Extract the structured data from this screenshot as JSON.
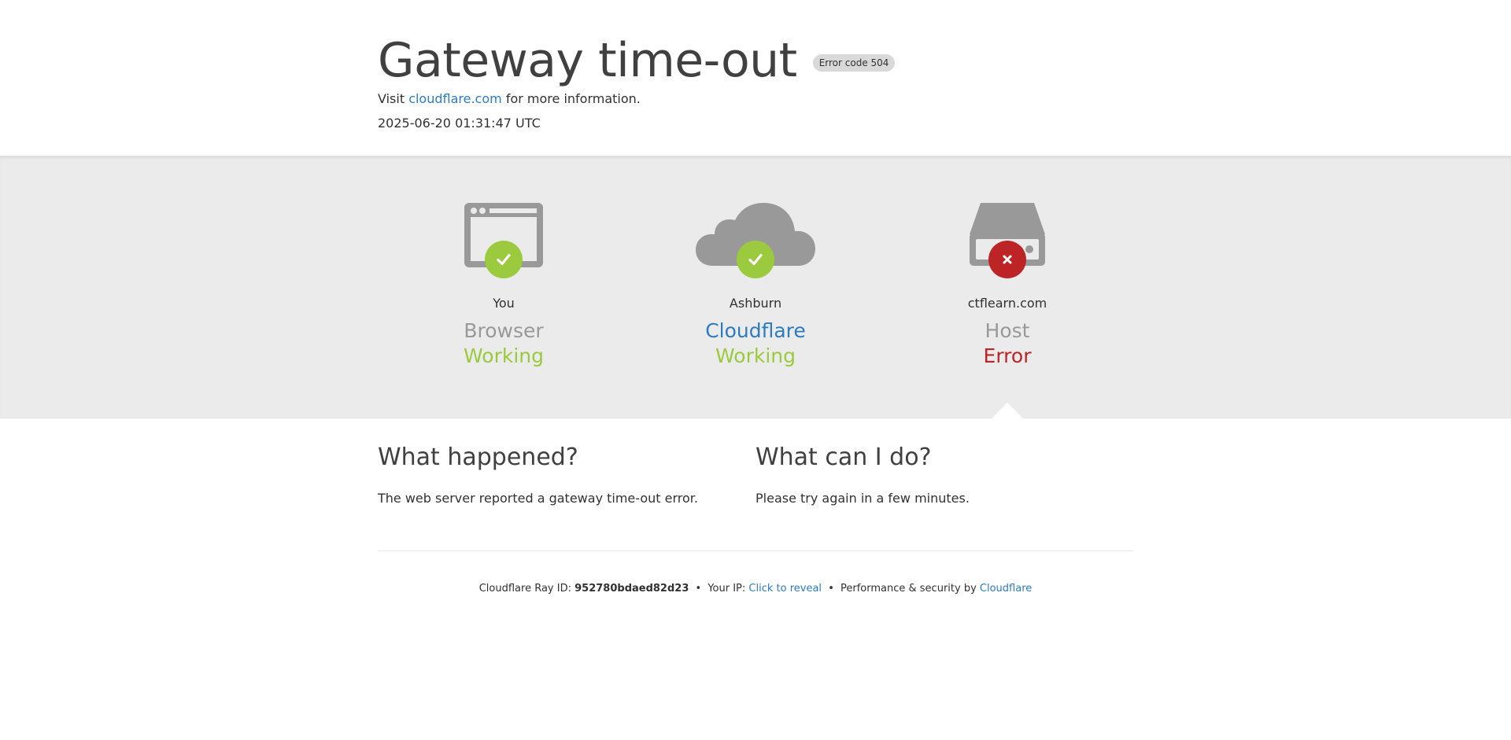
{
  "header": {
    "title": "Gateway time-out",
    "error_badge": "Error code 504",
    "visit_prefix": "Visit",
    "visit_link": "cloudflare.com",
    "visit_suffix": "for more information.",
    "timestamp": "2025-06-20 01:31:47 UTC"
  },
  "status": {
    "browser": {
      "location": "You",
      "role": "Browser",
      "state": "Working",
      "icon": "browser-window-icon",
      "status_icon": "checkmark-icon"
    },
    "cloudflare": {
      "location": "Ashburn",
      "role": "Cloudflare",
      "state": "Working",
      "icon": "cloud-icon",
      "status_icon": "checkmark-icon"
    },
    "host": {
      "location": "ctflearn.com",
      "role": "Host",
      "state": "Error",
      "icon": "server-icon",
      "status_icon": "x-icon"
    }
  },
  "info": {
    "what_happened_title": "What happened?",
    "what_happened_text": "The web server reported a gateway time-out error.",
    "what_can_i_do_title": "What can I do?",
    "what_can_i_do_text": "Please try again in a few minutes."
  },
  "footer": {
    "ray_label": "Cloudflare Ray ID:",
    "ray_id": "952780bdaed82d23",
    "separator": "•",
    "ip_label": "Your IP:",
    "ip_link": "Click to reveal",
    "perf_label": "Performance & security by",
    "perf_link": "Cloudflare"
  },
  "colors": {
    "ok": "#9bca3e",
    "error": "#bd2426",
    "link": "#2f7bbf",
    "icon_gray": "#999999",
    "band_bg": "#ebebeb"
  }
}
